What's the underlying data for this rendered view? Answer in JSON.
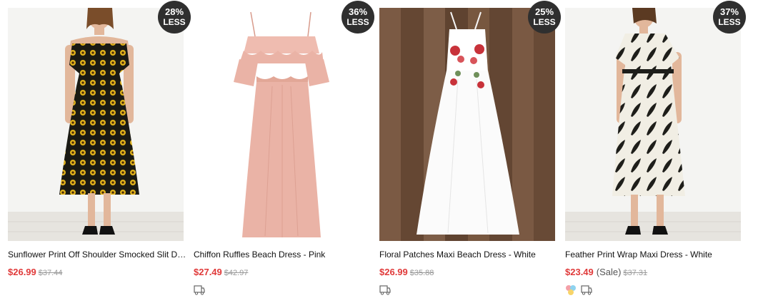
{
  "products": [
    {
      "badge": {
        "pct": "28%",
        "less": "LESS"
      },
      "title": "Sunflower Print Off Shoulder Smocked Slit Dress",
      "price": "$26.99",
      "sale_label": "",
      "original_price": "$37.44",
      "image": "dress-photo-sunflower",
      "colors": {
        "fabric": "#1a1a14",
        "accent": "#e0b21c",
        "background": "#f4f4f2"
      }
    },
    {
      "badge": {
        "pct": "36%",
        "less": "LESS"
      },
      "title": "Chiffon Ruffles Beach Dress - Pink",
      "price": "$27.49",
      "sale_label": "",
      "original_price": "$42.97",
      "image": "dress-photo-pink-chiffon",
      "colors": {
        "fabric": "#eab3a6",
        "background": "#ffffff"
      }
    },
    {
      "badge": {
        "pct": "25%",
        "less": "LESS"
      },
      "title": "Floral Patches Maxi Beach Dress - White",
      "price": "$26.99",
      "sale_label": "",
      "original_price": "$35.88",
      "image": "dress-photo-white-floral",
      "colors": {
        "fabric": "#ffffff",
        "accent": "#c8323a",
        "background": "#6f4f3a"
      }
    },
    {
      "badge": {
        "pct": "37%",
        "less": "LESS"
      },
      "title": "Feather Print Wrap Maxi Dress - White",
      "price": "$23.49",
      "sale_label": "(Sale)",
      "original_price": "$37.31",
      "image": "dress-photo-feather-print",
      "colors": {
        "fabric": "#f1eee4",
        "accent": "#1e1e1a",
        "background": "#f4f4f2"
      }
    }
  ],
  "icons": {
    "shipping": "truck-icon",
    "color_options": "color-swatch-icon"
  },
  "theme": {
    "price_color": "#e03a3a",
    "badge_color": "#2f2f2f",
    "muted_text": "#999999"
  }
}
